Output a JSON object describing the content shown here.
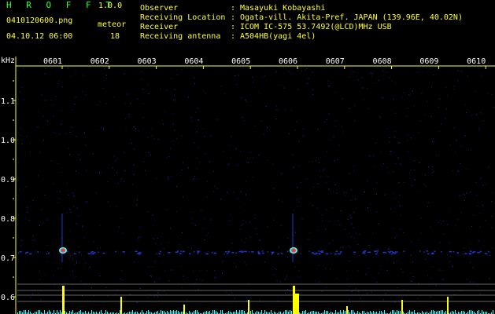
{
  "header": {
    "app_title": "H R O F F T",
    "app_version": "1.0.0",
    "file_name": "0410120600.png",
    "date_time": "04.10.12 06:00",
    "meteor_label": "meteor",
    "meteor_count": "18"
  },
  "info": [
    {
      "label": "Observer",
      "sep": ":",
      "value": "Masayuki Kobayashi"
    },
    {
      "label": "Receiving Location",
      "sep": ":",
      "value": "Ogata-vill. Akita-Pref. JAPAN (139.96E, 40.02N)"
    },
    {
      "label": "Receiver",
      "sep": ":",
      "value": "ICOM IC-575 53.7492(@LCD)MHz USB"
    },
    {
      "label": "Receiving antenna",
      "sep": ":",
      "value": "A504HB(yagi 4el)"
    }
  ],
  "spectrogram": {
    "y_unit": "kHz",
    "y_ticks": [
      "1.1",
      "1.0",
      "0.9",
      "0.8",
      "0.7",
      "0.6"
    ],
    "x_ticks": [
      "0601",
      "0602",
      "0603",
      "0604",
      "0605",
      "0606",
      "0607",
      "0608",
      "0609",
      "0610"
    ],
    "colors": {
      "axis": "#ffff33",
      "label_text": "#ffffff",
      "noise_blue": "#2233cc",
      "echo_red": "#ff3333",
      "echo_cyan": "#33ffff",
      "bar_yellow": "#ffff00",
      "bar_cyan": "#33ffff",
      "thin_lines": "#cccccc"
    }
  }
}
